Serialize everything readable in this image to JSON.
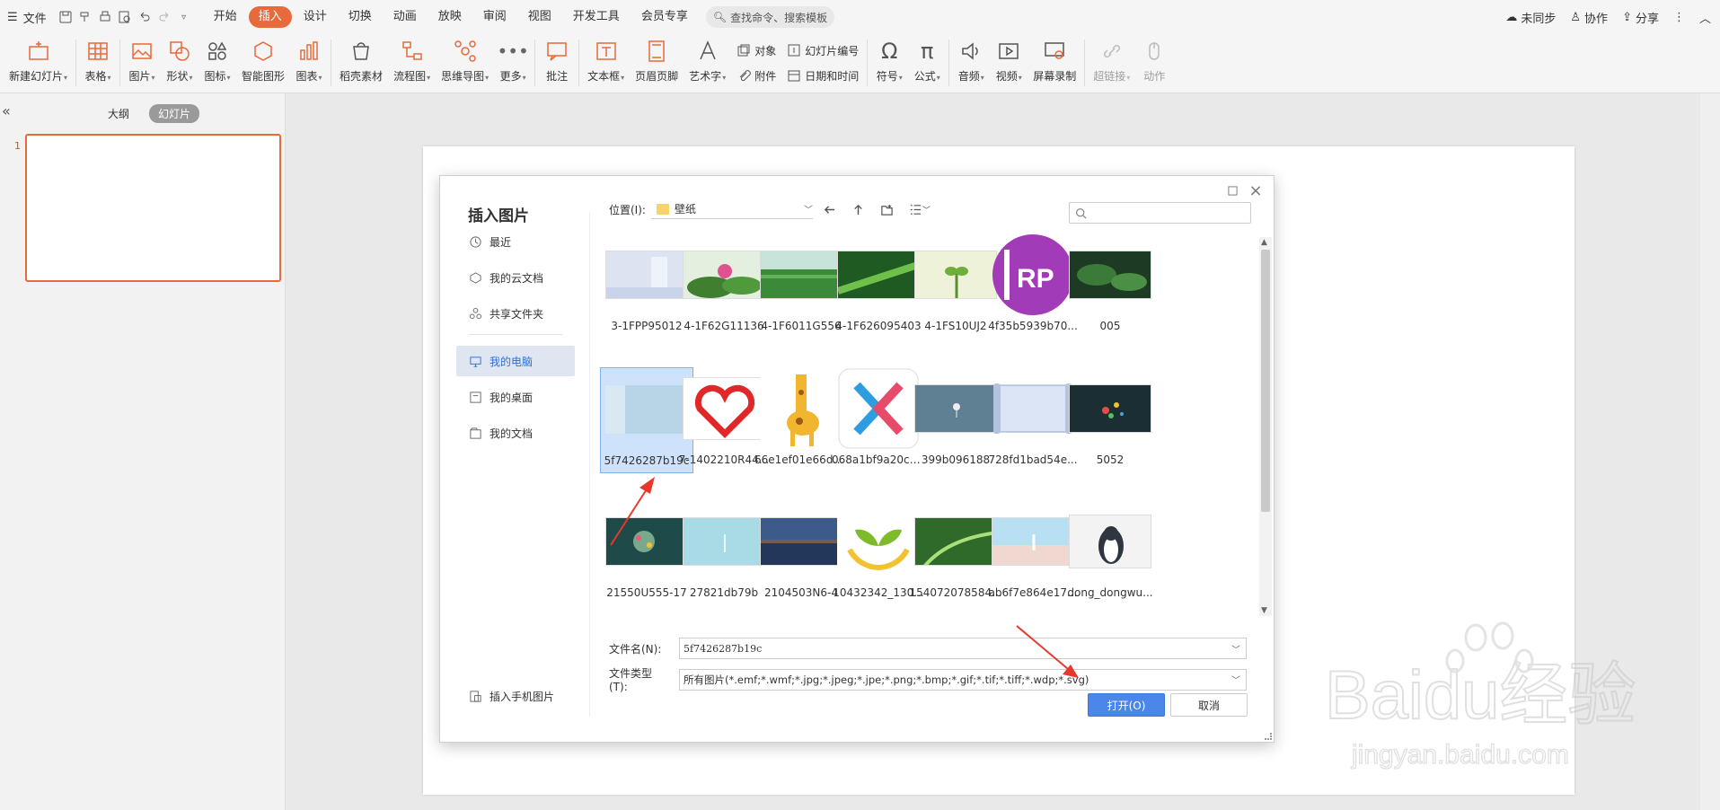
{
  "menubar": {
    "file_label": "文件",
    "tabs": [
      {
        "label": "开始"
      },
      {
        "label": "插入",
        "active": true
      },
      {
        "label": "设计"
      },
      {
        "label": "切换"
      },
      {
        "label": "动画"
      },
      {
        "label": "放映"
      },
      {
        "label": "审阅"
      },
      {
        "label": "视图"
      },
      {
        "label": "开发工具"
      },
      {
        "label": "会员专享"
      }
    ],
    "search_placeholder": "查找命令、搜索模板",
    "right": {
      "sync": "未同步",
      "collab": "协作",
      "share": "分享"
    }
  },
  "ribbon": {
    "new_slide": "新建幻灯片",
    "table": "表格",
    "picture": "图片",
    "shape": "形状",
    "icon": "图标",
    "smart_graphic": "智能图形",
    "chart": "图表",
    "material": "稻壳素材",
    "flowchart": "流程图",
    "mindmap": "思维导图",
    "more": "更多",
    "comment": "批注",
    "textbox": "文本框",
    "header_footer": "页眉页脚",
    "wordart": "艺术字",
    "object": "对象",
    "attachment": "附件",
    "slide_number": "幻灯片编号",
    "datetime": "日期和时间",
    "symbol": "符号",
    "formula": "公式",
    "audio": "音频",
    "video": "视频",
    "screen_record": "屏幕录制",
    "hyperlink": "超链接",
    "action": "动作"
  },
  "left_panel": {
    "tabs": [
      {
        "label": "大纲"
      },
      {
        "label": "幻灯片",
        "active": true
      }
    ],
    "slide_number": "1"
  },
  "dialog": {
    "title": "插入图片",
    "nav": [
      {
        "label": "最近",
        "icon": "clock-icon"
      },
      {
        "label": "我的云文档",
        "icon": "cloud-doc-icon"
      },
      {
        "label": "共享文件夹",
        "icon": "share-folder-icon"
      },
      {
        "label": "我的电脑",
        "icon": "computer-icon",
        "active": true
      },
      {
        "label": "我的桌面",
        "icon": "desktop-icon"
      },
      {
        "label": "我的文档",
        "icon": "documents-icon"
      }
    ],
    "phone_picture": "插入手机图片",
    "location_label": "位置(I):",
    "location_value": "壁纸",
    "files": [
      {
        "name": "3-1FPP95012",
        "thumb": "bg-a"
      },
      {
        "name": "4-1F62G11136",
        "thumb": "bg-b"
      },
      {
        "name": "4-1F6011G556",
        "thumb": "bg-c"
      },
      {
        "name": "4-1F626095403",
        "thumb": "bg-d"
      },
      {
        "name": "4-1FS10UJ2",
        "thumb": "bg-e"
      },
      {
        "name": "4f35b5939b70...",
        "thumb": "rp"
      },
      {
        "name": "005",
        "thumb": "bg-f"
      },
      {
        "name": "5f7426287b19c",
        "thumb": "bg-g",
        "selected": true
      },
      {
        "name": "7-1402210R44...",
        "thumb": "heart"
      },
      {
        "name": "66e1ef01e66d6...",
        "thumb": "giraffe"
      },
      {
        "name": "068a1bf9a20c6...",
        "thumb": "xlogo"
      },
      {
        "name": "399b096188",
        "thumb": "bg-h"
      },
      {
        "name": "728fd1bad54e...",
        "thumb": "scroll"
      },
      {
        "name": "5052",
        "thumb": "bg-i"
      },
      {
        "name": "21550U555-17",
        "thumb": "bg-j"
      },
      {
        "name": "27821db79b",
        "thumb": "bg-k"
      },
      {
        "name": "2104503N6-4",
        "thumb": "bg-l"
      },
      {
        "name": "10432342_130...",
        "thumb": "sprout"
      },
      {
        "name": "154072078584...",
        "thumb": "bg-m"
      },
      {
        "name": "ab6f7e864e17...",
        "thumb": "bg-n"
      },
      {
        "name": "dong_dongwu...",
        "thumb": "penguin"
      }
    ],
    "filename_label": "文件名(N):",
    "filename_value": "5f7426287b19c",
    "filetype_label": "文件类型(T):",
    "filetype_value": "所有图片(*.emf;*.wmf;*.jpg;*.jpeg;*.jpe;*.png;*.bmp;*.gif;*.tif;*.tiff;*.wdp;*.svg)",
    "open_button": "打开(O)",
    "cancel_button": "取消"
  },
  "watermark": {
    "text": "Baidu经验",
    "url_text": "jingyan.baidu.com"
  },
  "colors": {
    "accent": "#e8693a",
    "primary_button": "#4b86e8",
    "arrow": "#e8372c"
  }
}
